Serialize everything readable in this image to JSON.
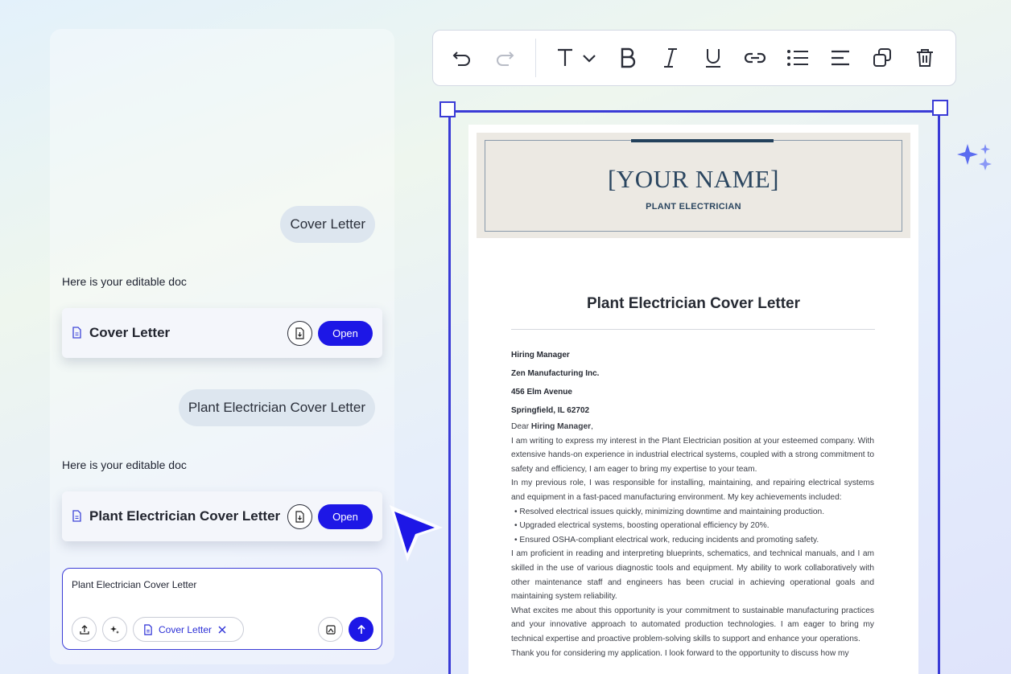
{
  "chat": {
    "messages": [
      {
        "role": "user",
        "text": "Cover Letter"
      },
      {
        "role": "assistant",
        "text": "Here is your editable doc",
        "doc_title": "Cover Letter",
        "open_label": "Open"
      },
      {
        "role": "user",
        "text": "Plant Electrician Cover Letter"
      },
      {
        "role": "assistant",
        "text": "Here is your editable doc",
        "doc_title": "Plant Electrician Cover Letter",
        "open_label": "Open"
      }
    ],
    "input": {
      "value": "Plant Electrician Cover Letter",
      "chip_label": "Cover Letter"
    }
  },
  "toolbar": {
    "icons": [
      "undo-icon",
      "redo-icon",
      "text-style-icon",
      "bold-icon",
      "italic-icon",
      "underline-icon",
      "link-icon",
      "bullet-list-icon",
      "align-left-icon",
      "duplicate-icon",
      "delete-icon"
    ]
  },
  "document": {
    "name": "[YOUR NAME]",
    "job_title": "PLANT ELECTRICIAN",
    "heading": "Plant Electrician Cover Letter",
    "recipient": [
      "Hiring Manager",
      "Zen Manufacturing Inc.",
      "456 Elm Avenue",
      "Springfield, IL 62702"
    ],
    "greeting_prefix": "Dear ",
    "greeting_name": "Hiring Manager",
    "greeting_suffix": ",",
    "paragraphs": {
      "p1": "I am writing to express my interest in the Plant Electrician position at your esteemed company. With extensive hands-on experience in industrial electrical systems, coupled with a strong commitment to safety and efficiency, I am eager to bring my expertise to your team.",
      "p2": "In my previous role, I was responsible for installing, maintaining, and repairing electrical systems and equipment in a fast-paced manufacturing environment. My key achievements included:",
      "b1": "• Resolved electrical issues quickly, minimizing downtime and maintaining production.",
      "b2": "• Upgraded electrical systems, boosting operational efficiency by 20%.",
      "b3": "• Ensured OSHA-compliant electrical work, reducing incidents and promoting safety.",
      "p3": "I am proficient in reading and interpreting blueprints, schematics, and technical manuals, and I am skilled in the use of various diagnostic tools and equipment. My ability to work collaboratively with other maintenance staff and engineers has been crucial in achieving operational goals and maintaining system reliability.",
      "p4": "What excites me about this opportunity is your commitment to sustainable manufacturing practices and your innovative approach to automated production technologies. I am eager to bring my technical expertise and proactive problem-solving skills to support and enhance your operations.",
      "p5": "Thank you for considering my application. I look forward to the opportunity to discuss how my"
    }
  },
  "colors": {
    "accent": "#1d17e6",
    "frame": "#3a3bd6",
    "header_band": "#ece9e3",
    "name_color": "#2b4660"
  }
}
